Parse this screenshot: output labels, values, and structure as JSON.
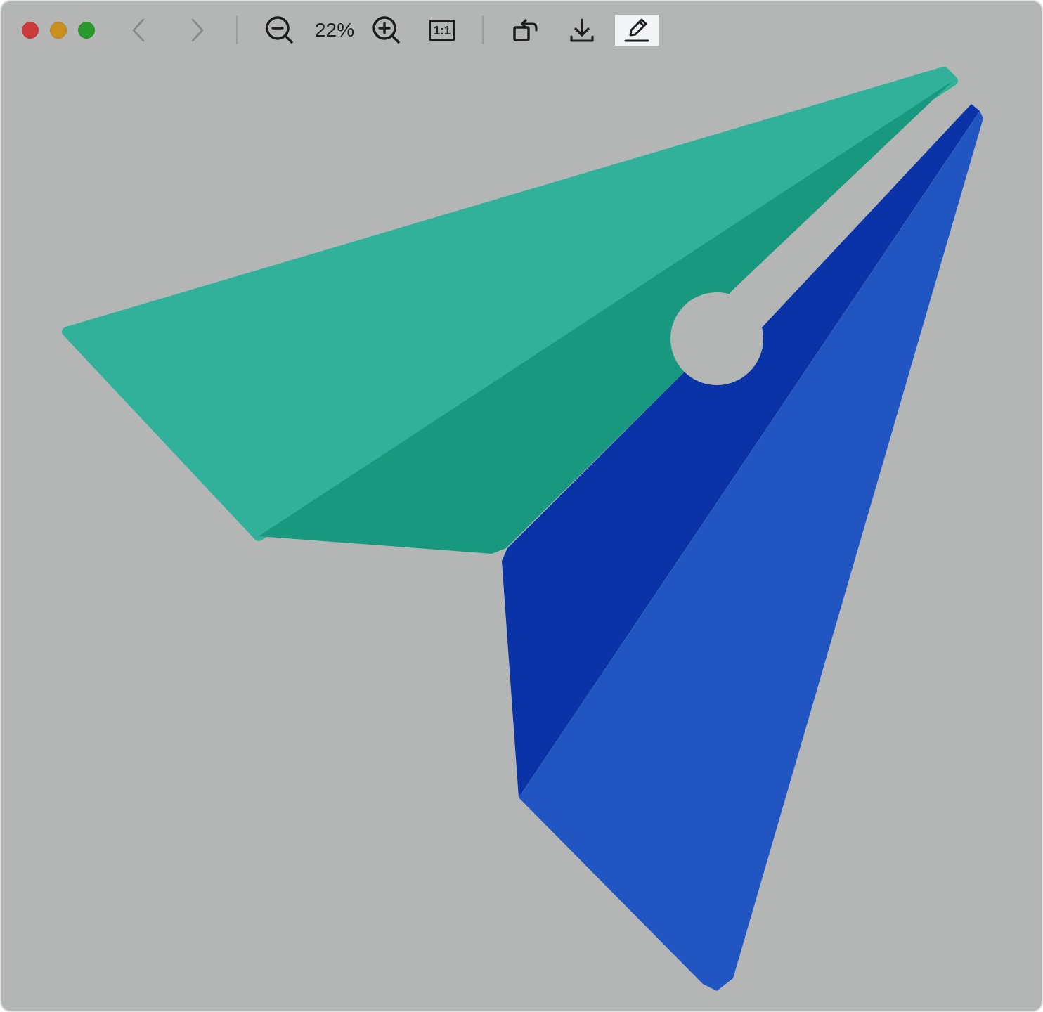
{
  "window": {
    "controls": [
      {
        "kind": "close"
      },
      {
        "kind": "minimize"
      },
      {
        "kind": "zoom"
      }
    ]
  },
  "toolbar": {
    "items": [
      {
        "kind": "back",
        "disabled": true,
        "selected": false
      },
      {
        "kind": "forward",
        "disabled": true,
        "selected": false
      },
      {
        "kind": "divider"
      },
      {
        "kind": "zoom_out",
        "disabled": false,
        "selected": false
      },
      {
        "kind": "zoom_level",
        "text": "22%"
      },
      {
        "kind": "zoom_in",
        "disabled": false,
        "selected": false
      },
      {
        "kind": "actual_size",
        "text": "1:1",
        "disabled": false,
        "selected": false
      },
      {
        "kind": "divider"
      },
      {
        "kind": "rotate",
        "disabled": false,
        "selected": false
      },
      {
        "kind": "download",
        "disabled": false,
        "selected": false
      },
      {
        "kind": "markup",
        "disabled": false,
        "selected": true
      }
    ]
  }
}
